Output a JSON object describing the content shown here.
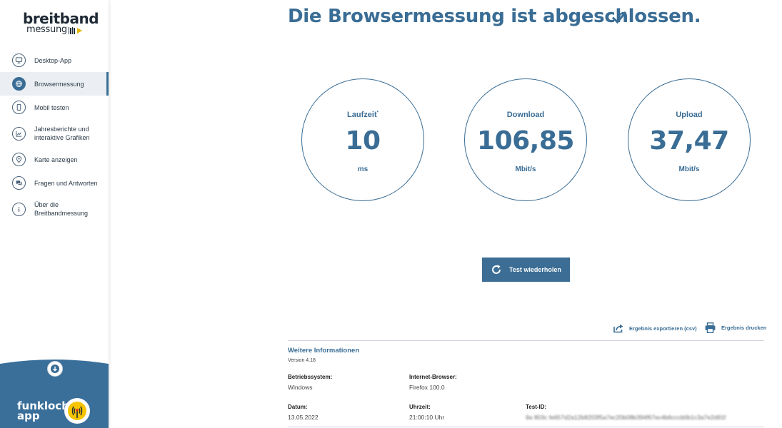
{
  "sidebar": {
    "logo_line1": "breitband",
    "logo_line2": "messung",
    "items": [
      {
        "label": "Desktop-App",
        "active": false
      },
      {
        "label": "Browsermessung",
        "active": true
      },
      {
        "label": "Mobil testen",
        "active": false
      },
      {
        "label_line1": "Jahresberichte und",
        "label_line2": "interaktive Grafiken",
        "active": false
      },
      {
        "label": "Karte anzeigen",
        "active": false
      },
      {
        "label": "Fragen und Antworten",
        "active": false
      },
      {
        "label_line1": "Über die",
        "label_line2": "Breitbandmessung",
        "active": false
      }
    ],
    "footer_line1": "funkloch-",
    "footer_line2": "app"
  },
  "main": {
    "title": "Die Browsermessung ist abgeschlossen.",
    "gauges": [
      {
        "label": "Laufzeit",
        "marker": "*",
        "value": "10",
        "unit": "ms"
      },
      {
        "label": "Download",
        "value": "106,85",
        "unit": "Mbit/s"
      },
      {
        "label": "Upload",
        "value": "37,47",
        "unit": "Mbit/s"
      }
    ],
    "repeat_button": "Test wiederholen",
    "export_label": "Ergebnis exportieren (csv)",
    "print_label": "Ergebnis drucken"
  },
  "info": {
    "title": "Weitere Informationen",
    "version": "Version 4.18",
    "os_label": "Betriebssystem:",
    "os_value": "Windows",
    "browser_label": "Internet-Browser:",
    "browser_value": "Firefox 100.0",
    "date_label": "Datum:",
    "date_value": "13.05.2022",
    "time_label": "Uhrzeit:",
    "time_value": "21:00:10 Uhr",
    "testid_label": "Test-ID:",
    "testid_value": "9a 803c fe657d2a12b8203f5a7ec20b08b394f67ec4b6cccb0b1c3a7e2d91f"
  },
  "colors": {
    "accent": "#3a6d95",
    "sidebar_footer": "#3a6f9a",
    "active_bg": "#ebeff3",
    "logo_yellow": "#e6b400"
  }
}
